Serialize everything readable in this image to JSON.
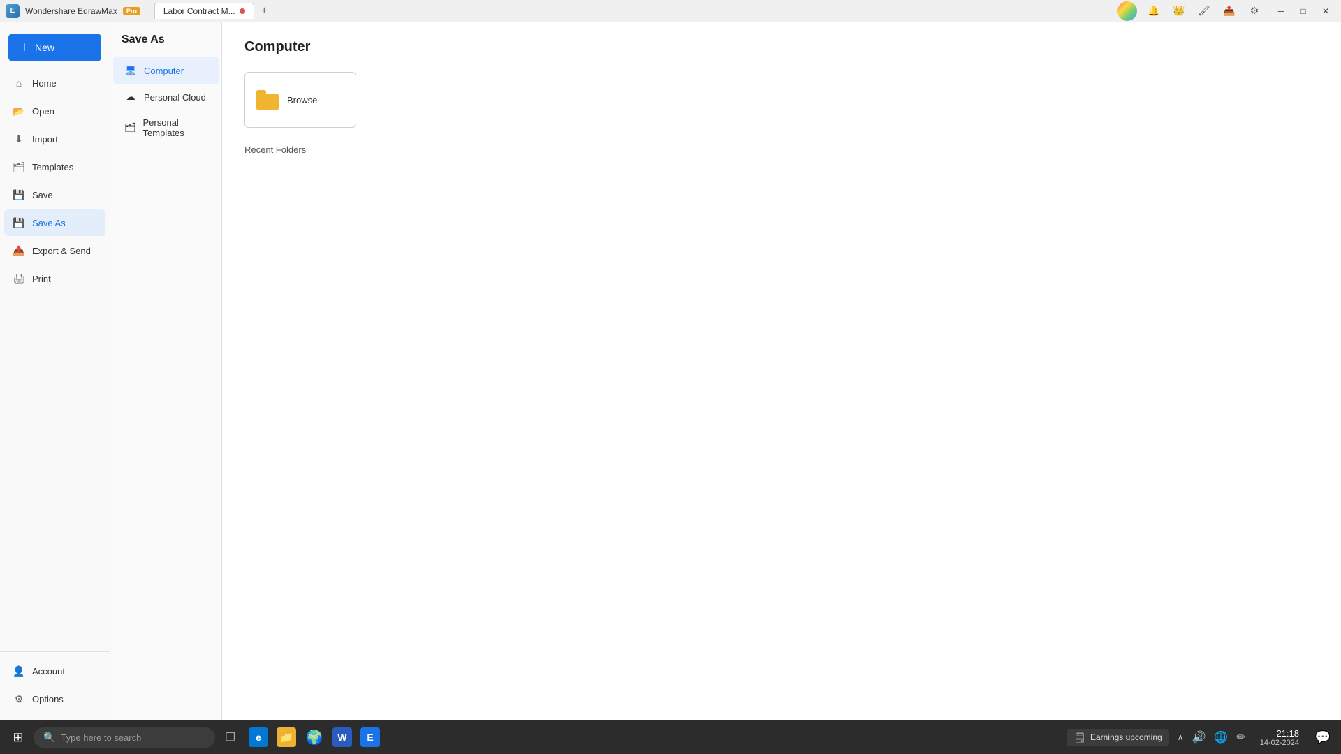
{
  "titlebar": {
    "app_name": "Wondershare EdrawMax",
    "pro_label": "Pro",
    "tab_label": "Labor Contract M...",
    "tab_add": "+",
    "minimize_label": "─",
    "maximize_label": "□",
    "close_label": "✕"
  },
  "toolbar_icons": {
    "bell": "🔔",
    "crown": "👑",
    "brush": "🖌",
    "share": "📤",
    "settings": "⚙"
  },
  "sidebar": {
    "new_label": "New",
    "items": [
      {
        "id": "home",
        "label": "Home",
        "icon": "⌂"
      },
      {
        "id": "open",
        "label": "Open",
        "icon": "📂"
      },
      {
        "id": "import",
        "label": "Import",
        "icon": "⬇"
      },
      {
        "id": "templates",
        "label": "Templates",
        "icon": "🗂"
      },
      {
        "id": "save",
        "label": "Save",
        "icon": "💾"
      },
      {
        "id": "save-as",
        "label": "Save As",
        "icon": "💾"
      },
      {
        "id": "export",
        "label": "Export & Send",
        "icon": "📤"
      },
      {
        "id": "print",
        "label": "Print",
        "icon": "🖨"
      }
    ],
    "bottom_items": [
      {
        "id": "account",
        "label": "Account",
        "icon": "👤"
      },
      {
        "id": "options",
        "label": "Options",
        "icon": "⚙"
      }
    ]
  },
  "middle_panel": {
    "title": "Save As",
    "items": [
      {
        "id": "computer",
        "label": "Computer",
        "icon": "🖥"
      },
      {
        "id": "personal-cloud",
        "label": "Personal Cloud",
        "icon": "☁"
      },
      {
        "id": "personal-templates",
        "label": "Personal Templates",
        "icon": "🗂"
      }
    ]
  },
  "content": {
    "header": "Computer",
    "browse_label": "Browse",
    "recent_folders_label": "Recent Folders"
  },
  "taskbar": {
    "start_icon": "⊞",
    "search_placeholder": "Type here to search",
    "apps": [
      {
        "id": "windows",
        "icon": "⊞",
        "color": "#0078d4"
      },
      {
        "id": "task-view",
        "icon": "❐",
        "color": "#555"
      },
      {
        "id": "edge",
        "icon": "🌐",
        "color": "#0078d4"
      },
      {
        "id": "explorer",
        "icon": "📁",
        "color": "#f0b030"
      },
      {
        "id": "chrome",
        "icon": "🌍",
        "color": "#4285f4"
      },
      {
        "id": "word",
        "icon": "W",
        "color": "#2b5cbd"
      },
      {
        "id": "edraw",
        "icon": "E",
        "color": "#1a73e8"
      }
    ],
    "notification_text": "Earnings upcoming",
    "sys_icons": [
      "🔊",
      "🌐",
      "✏"
    ],
    "time": "21:18",
    "date": "14-02-2024",
    "chat_icon": "💬"
  }
}
